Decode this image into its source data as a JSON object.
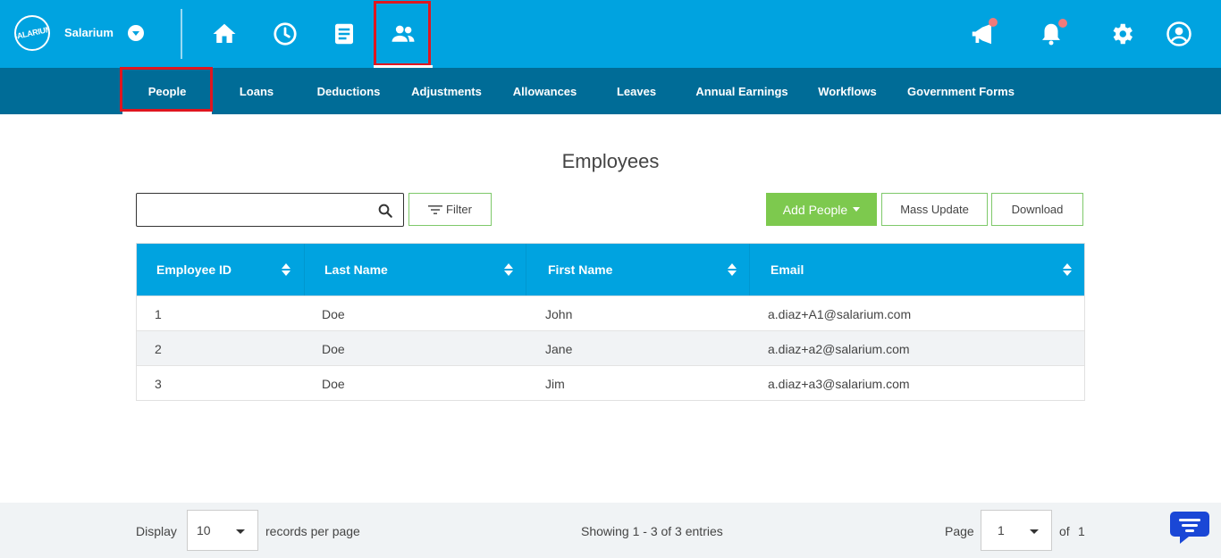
{
  "brand": {
    "logo_text": "SALARIUM",
    "name": "Salarium"
  },
  "subnav": [
    {
      "label": "People"
    },
    {
      "label": "Loans"
    },
    {
      "label": "Deductions"
    },
    {
      "label": "Adjustments"
    },
    {
      "label": "Allowances"
    },
    {
      "label": "Leaves"
    },
    {
      "label": "Annual Earnings"
    },
    {
      "label": "Workflows"
    },
    {
      "label": "Government Forms"
    }
  ],
  "page": {
    "title": "Employees"
  },
  "toolbar": {
    "search_placeholder": "",
    "filter_label": "Filter",
    "add_label": "Add People",
    "mass_update_label": "Mass Update",
    "download_label": "Download"
  },
  "table": {
    "columns": [
      "Employee ID",
      "Last Name",
      "First Name",
      "Email"
    ],
    "rows": [
      [
        "1",
        "Doe",
        "John",
        "a.diaz+A1@salarium.com"
      ],
      [
        "2",
        "Doe",
        "Jane",
        "a.diaz+a2@salarium.com"
      ],
      [
        "3",
        "Doe",
        "Jim",
        "a.diaz+a3@salarium.com"
      ]
    ]
  },
  "footer": {
    "display_label": "Display",
    "per_page_value": "10",
    "records_label": "records per page",
    "showing": "Showing 1 - 3 of 3 entries",
    "page_label": "Page",
    "page_value": "1",
    "of_label": "of",
    "total_pages": "1"
  },
  "colors": {
    "primary": "#00a3e0",
    "subnav": "#006c97",
    "add_button": "#7dc94e",
    "highlight": "#e0161f"
  },
  "icons": [
    "home-icon",
    "clock-icon",
    "document-icon",
    "people-icon",
    "megaphone-icon",
    "bell-icon",
    "gear-icon",
    "user-icon",
    "search-icon",
    "filter-icon",
    "chat-icon"
  ]
}
